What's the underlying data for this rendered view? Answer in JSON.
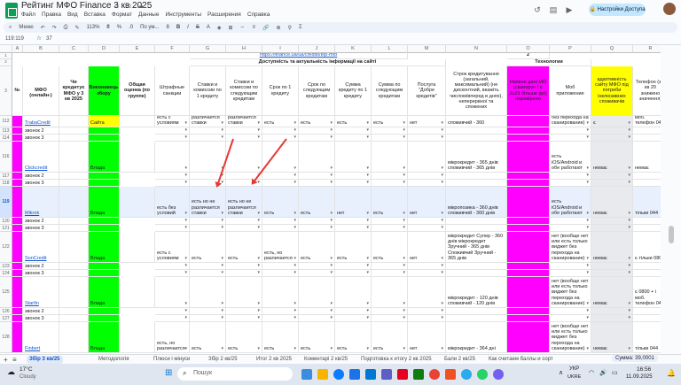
{
  "window": {
    "title": "Рейтинг МФО Finance 3 кв 2025",
    "menu": [
      "Файл",
      "Правка",
      "Вид",
      "Вставка",
      "Формат",
      "Данные",
      "Инструменты",
      "Расширения",
      "Справка"
    ],
    "share_label": "Настройки Доступа"
  },
  "toolbar": {
    "menu_label": "Меню",
    "zoom": "113%",
    "font": "По ум...",
    "font_size": "8"
  },
  "formula_bar": {
    "cell_ref": "119:119",
    "fx": "fx",
    "value": "37"
  },
  "columns": [
    "",
    "A",
    "B",
    "C",
    "D",
    "E",
    "F",
    "G",
    "H",
    "I",
    "J",
    "K",
    "L",
    "M",
    "N",
    "O",
    "P",
    "Q",
    "R"
  ],
  "header": {
    "url_link": "https://finance.ua/ua/credits/top-mfo",
    "group_main": "Доступність та актуальність інформації на сайті",
    "group_tech": "Технологии",
    "num2": "2",
    "col_no": "№",
    "col_name": "МФО (онлайн-)",
    "col_credits": "Чи кредитує МФО у 3 кв 2025",
    "col_result": "Виконавець збору",
    "col_total": "Общая оценка (по группе)",
    "col_fines": "Штрафные санкции",
    "col_rates1": "Ставки и комиссии по 1 кредиту",
    "col_rates2": "Ставки и комиссии по следующим кредитам",
    "col_term1": "Срок по 1 кредиту",
    "col_term2": "Срок по следующим кредитам",
    "col_sum1": "Сумма кредиту по 1 кредиту",
    "col_sum2": "Сумма по следующим кредитам",
    "col_loyalty": "Послуга \"Добре кредитів\"",
    "col_term_loan": "Строк кредитування (загальний, максимальний) (не дисконтний, вкажіть числом/вперед в днях), неперервної та спожених",
    "col_verif": "Наявне дані МО (сканерун ( є 2023 більше ідо) перевірено",
    "col_mobile": "Моб приложение",
    "col_adapt": "адаптивність сайту МФО під потреби інклюзивних споживачів",
    "col_phone": "Телефон (з 2 кв 20 знижено значення)"
  },
  "rows": [
    {
      "num": "112",
      "name": "TrabaCredit",
      "result": "Сайта",
      "fines": "есть с условиям",
      "rates1": "есть но не различается ставки",
      "rates2": "есть но не различается ставки",
      "term1": "есть",
      "term2": "есть",
      "sum1": "есть",
      "sum2": "есть",
      "loyalty": "нет",
      "term_loan": "споживчий - 360",
      "mobile": "только виджет без перехода на сканирование)",
      "adapt": "є",
      "phone": "є 0800 + і моб. телефон 044"
    },
    {
      "num": "113",
      "label": "звонок 2"
    },
    {
      "num": "114",
      "label": "звонок 3"
    },
    {
      "num": "116",
      "name": "Clickcredit",
      "result": "Влада",
      "term_loan": "мікрокредит - 365 днів споживчий - 365 днів",
      "mobile": "есть iOS/Android и обе работают",
      "adapt": "немає",
      "phone": "немає"
    },
    {
      "num": "117",
      "label": "звонок 2"
    },
    {
      "num": "118",
      "label": "звонок 3"
    },
    {
      "num": "119",
      "name": "Mikrok",
      "result": "Влада",
      "fines": "есть без условий",
      "rates1": "есть но не различается ставки",
      "rates2": "есть но не различается ставки",
      "term1": "есть",
      "term2": "есть",
      "sum1": "нет",
      "sum2": "есть",
      "loyalty": "нет",
      "term_loan": "мікропозика - 360 днів споживчий - 360 днів",
      "mobile": "есть iOS/Android и обе работают",
      "adapt": "немає",
      "phone": "тільки 044"
    },
    {
      "num": "120",
      "label": "звонок 2"
    },
    {
      "num": "121",
      "label": "звонок 3"
    },
    {
      "num": "122",
      "name": "SonCredit",
      "result": "Влада",
      "fines": "есть с условиям",
      "rates1": "есть",
      "rates2": "есть",
      "term1": "есть, но различается",
      "term2": "есть",
      "sum1": "есть",
      "sum2": "есть",
      "loyalty": "нет",
      "term_loan": "мікрокредит Супер - 360 днів мікрокредит Зручний - 365 днів Споживчий Зручний - 365 днів",
      "mobile": "нет (вообще нет или есть только виджет без перехода на сканирование)",
      "adapt": "немає",
      "phone": "є тільки 0800"
    },
    {
      "num": "123",
      "label": "звонок 2"
    },
    {
      "num": "124",
      "label": "звонок 3"
    },
    {
      "num": "125",
      "name": "Starfin",
      "result": "Влада",
      "term_loan": "мікрокредит - 120 днів споживчий - 120 днів",
      "mobile": "нет (вообще нет или есть только виджет без перехода на сканирование)",
      "adapt": "немає",
      "phone": "є 0800 + і моб. телефон 044"
    },
    {
      "num": "126",
      "label": "звонок 2"
    },
    {
      "num": "127",
      "label": "звонок 3"
    },
    {
      "num": "128",
      "name": "Finbert",
      "result": "Влада",
      "fines": "есть, но различается",
      "rates1": "есть",
      "rates2": "есть",
      "term1": "есть",
      "term2": "есть",
      "sum1": "есть",
      "sum2": "есть",
      "loyalty": "нет",
      "term_loan": "мікрокредит - 364 дні",
      "mobile": "нет (вообще нет или есть только виджет без перехода на сканирование)",
      "adapt": "немає",
      "phone": "тільки 044"
    }
  ],
  "sheet_tabs": [
    "Збір 3 кв/25",
    "Методологія",
    "Плюси і мінуси",
    "Збір 2 кв/25",
    "Итог 2 кв 2025",
    "Коментарі 2 кв/25",
    "Подготовка к итогу 2 кв 2025",
    "Бали 2 кв/25",
    "Как считаем баллы и сорт"
  ],
  "sum_label": "Сумма: 39,0001",
  "taskbar": {
    "weather_temp": "17°C",
    "weather_desc": "Cloudy",
    "search_placeholder": "Пошук",
    "lang": "УКР",
    "lang2": "UKRE",
    "time": "16:56",
    "date": "11.09.2025"
  },
  "colors": {
    "magenta": "#ff00ff",
    "yellow": "#ffff00",
    "green": "#00ff00",
    "grey_row": "#e8eaed",
    "selected_row": "#e8f0fe",
    "arrow": "#e53935"
  }
}
